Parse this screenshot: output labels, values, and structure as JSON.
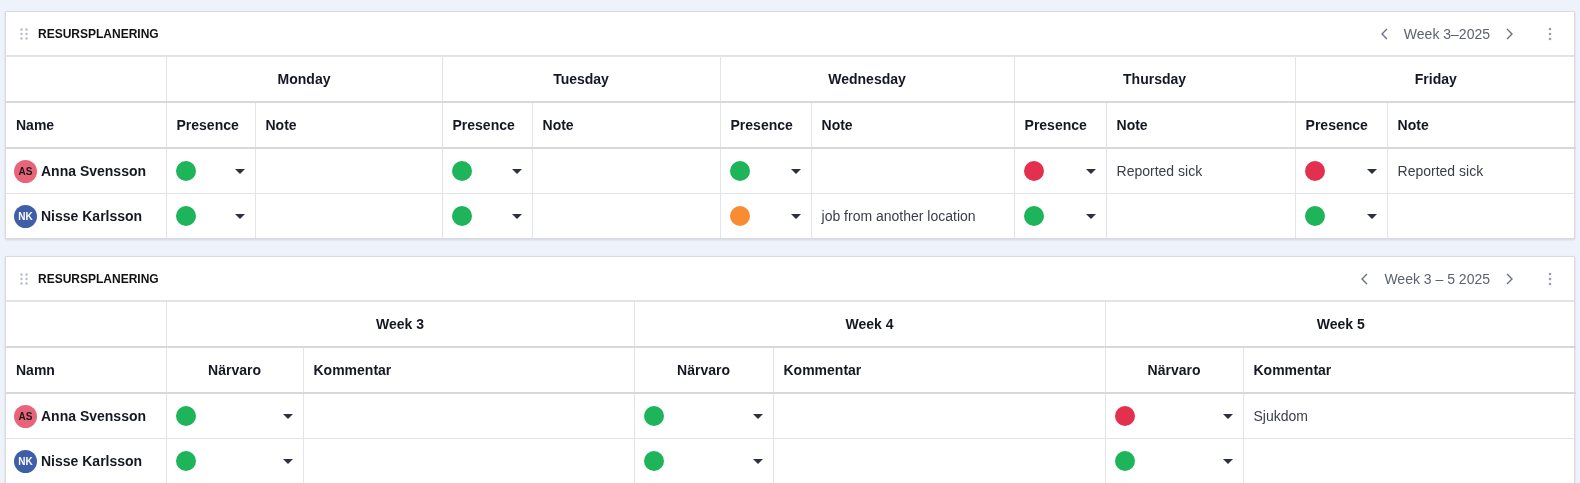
{
  "panels": [
    {
      "kind": "days",
      "title": "RESURSPLANERING",
      "range": "Week 3–2025",
      "name_header": "Name",
      "groups": [
        {
          "label": "Monday",
          "presence_header": "Presence",
          "note_header": "Note"
        },
        {
          "label": "Tuesday",
          "presence_header": "Presence",
          "note_header": "Note"
        },
        {
          "label": "Wednesday",
          "presence_header": "Presence",
          "note_header": "Note"
        },
        {
          "label": "Thursday",
          "presence_header": "Presence",
          "note_header": "Note"
        },
        {
          "label": "Friday",
          "presence_header": "Presence",
          "note_header": "Note"
        }
      ],
      "rows": [
        {
          "avatar": {
            "initials": "AS",
            "color": "#e8647a"
          },
          "name": "Anna Svensson",
          "cells": [
            {
              "color": "#1db45a"
            },
            {
              "color": "#1db45a"
            },
            {
              "color": "#1db45a"
            },
            {
              "color": "#e3304f",
              "note": "Reported sick"
            },
            {
              "color": "#e3304f",
              "note": "Reported sick"
            }
          ]
        },
        {
          "avatar": {
            "initials": "NK",
            "color": "#3f5ea8"
          },
          "name": "Nisse Karlsson",
          "cells": [
            {
              "color": "#1db45a"
            },
            {
              "color": "#1db45a"
            },
            {
              "color": "#f88c33",
              "note": "job from another location"
            },
            {
              "color": "#1db45a"
            },
            {
              "color": "#1db45a"
            }
          ]
        }
      ]
    },
    {
      "kind": "weeks",
      "title": "RESURSPLANERING",
      "range": "Week 3 – 5 2025",
      "name_header": "Namn",
      "groups": [
        {
          "label": "Week 3",
          "presence_header": "Närvaro",
          "note_header": "Kommentar"
        },
        {
          "label": "Week 4",
          "presence_header": "Närvaro",
          "note_header": "Kommentar"
        },
        {
          "label": "Week 5",
          "presence_header": "Närvaro",
          "note_header": "Kommentar"
        }
      ],
      "rows": [
        {
          "avatar": {
            "initials": "AS",
            "color": "#e8647a"
          },
          "name": "Anna Svensson",
          "cells": [
            {
              "color": "#1db45a"
            },
            {
              "color": "#1db45a"
            },
            {
              "color": "#e3304f",
              "note": "Sjukdom"
            }
          ]
        },
        {
          "avatar": {
            "initials": "NK",
            "color": "#3f5ea8"
          },
          "name": "Nisse Karlsson",
          "cells": [
            {
              "color": "#1db45a"
            },
            {
              "color": "#1db45a"
            },
            {
              "color": "#1db45a"
            }
          ]
        }
      ]
    }
  ]
}
